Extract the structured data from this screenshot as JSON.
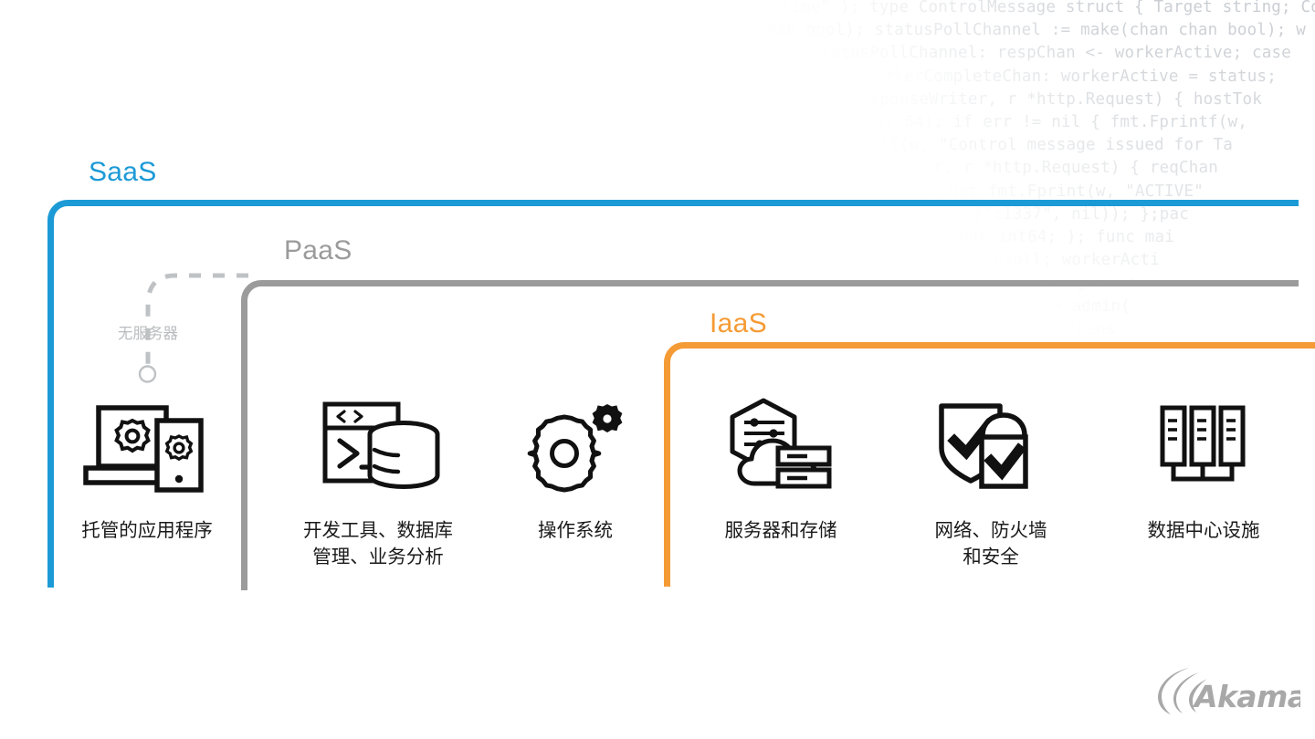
{
  "background_code": {
    "language": "go",
    "lines": [
      "\"time\" ); type ControlMessage struct { Target string; Co",
      "chan bool); statusPollChannel := make(chan chan bool); w",
      "statusPollChannel: respChan <- workerActive; case",
      "workerCompleteChan: workerActive = status;",
      "ResponseWriter, r *http.Request) { hostTok",
      "10, 64); if err != nil { fmt.Fprintf(w,",
      "intf(w, \"Control message issued for Ta",
      "iter, r *http.Request) { reqChan",
      "if not fmt.Fprint(w, \"ACTIVE\"",
      "erve(\":1337\", nil)); };pac",
      "Count int64; ); func mai",
      "<- bpoll; workerActi",
      "case msg := <-",
      "gs := admin(",
      "tokens"
    ]
  },
  "tiers": [
    {
      "id": "saas",
      "label": "SaaS",
      "color": "#1c9ad6"
    },
    {
      "id": "paas",
      "label": "PaaS",
      "color": "#9b9b9b"
    },
    {
      "id": "iaas",
      "label": "IaaS",
      "color": "#f59b35"
    }
  ],
  "serverless": {
    "label": "无服务器",
    "color": "#b9bcbf"
  },
  "columns": [
    {
      "id": "hosted-apps",
      "icon": "laptop-phone-gear-icon",
      "label": "托管的应用程序"
    },
    {
      "id": "dev-tools",
      "icon": "code-window-database-icon",
      "label": "开发工具、数据库\n管理、业务分析"
    },
    {
      "id": "os",
      "icon": "gears-icon",
      "label": "操作系统"
    },
    {
      "id": "servers",
      "icon": "hexagon-cloud-server-icon",
      "label": "服务器和存储"
    },
    {
      "id": "network",
      "icon": "shield-lock-check-icon",
      "label": "网络、防火墙\n和安全"
    },
    {
      "id": "datacenter",
      "icon": "server-racks-icon",
      "label": "数据中心设施"
    }
  ],
  "logo": {
    "name": "Akamai",
    "color": "#a8a8a8"
  }
}
